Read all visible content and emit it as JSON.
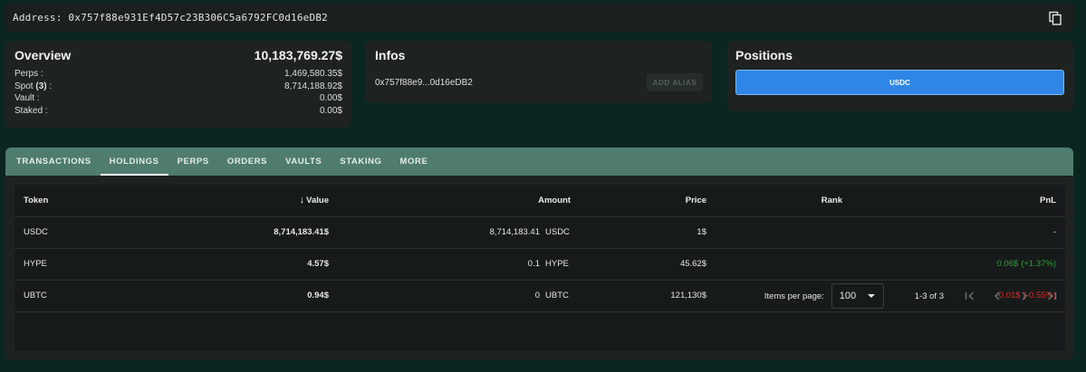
{
  "address_bar": {
    "label": "Address:",
    "address": "0x757f88e931Ef4D57c23B306C5a6792FC0d16eDB2"
  },
  "overview": {
    "title": "Overview",
    "total": "10,183,769.27$",
    "rows": [
      {
        "label": "Perps :",
        "value": "1,469,580.35$"
      },
      {
        "label": "Spot ",
        "count": "(3)",
        "suffix": " :",
        "value": "8,714,188.92$"
      },
      {
        "label": "Vault :",
        "value": "0.00$"
      },
      {
        "label": "Staked :",
        "value": "0.00$"
      }
    ]
  },
  "infos": {
    "title": "Infos",
    "short_address": "0x757f88e9...0d16eDB2",
    "alias_button": "ADD ALIAS"
  },
  "positions": {
    "title": "Positions",
    "button": "USDC"
  },
  "tabs": [
    {
      "label": "TRANSACTIONS",
      "active": false
    },
    {
      "label": "HOLDINGS",
      "active": true
    },
    {
      "label": "PERPS",
      "active": false
    },
    {
      "label": "ORDERS",
      "active": false
    },
    {
      "label": "VAULTS",
      "active": false
    },
    {
      "label": "STAKING",
      "active": false
    },
    {
      "label": "MORE",
      "active": false
    }
  ],
  "table": {
    "headers": {
      "token": "Token",
      "value": "Value",
      "amount": "Amount",
      "price": "Price",
      "rank": "Rank",
      "pnl": "PnL"
    },
    "rows": [
      {
        "token": "USDC",
        "value": "8,714,183.41$",
        "amount": "8,714,183.41",
        "unit": "USDC",
        "price": "1$",
        "rank": "",
        "pnl": "-",
        "pnl_pct": ""
      },
      {
        "token": "HYPE",
        "value": "4.57$",
        "amount": "0.1",
        "unit": "HYPE",
        "price": "45.62$",
        "rank": "",
        "pnl": "0.06$",
        "pnl_pct": "(+1.37%)"
      },
      {
        "token": "UBTC",
        "value": "0.94$",
        "amount": "0",
        "unit": "UBTC",
        "price": "121,130$",
        "rank": "",
        "pnl": "-0.01$",
        "pnl_pct": "(-0.55%)"
      }
    ]
  },
  "pagination": {
    "items_per_page_label": "Items per page:",
    "items_per_page": "100",
    "range": "1-3 of 3"
  },
  "colors": {
    "background": "#0b2620",
    "tab_bar": "#4f7c6e",
    "accent_blue": "#2f86e6",
    "pnl_positive": "#2e9e3a",
    "pnl_negative": "#e02a2a"
  },
  "icons": {
    "copy": "copy-icon",
    "sort": "arrow-down-icon",
    "dropdown": "caret-down-icon",
    "first_page": "first-page-icon",
    "prev_page": "chevron-left-icon",
    "next_page": "chevron-right-icon",
    "last_page": "last-page-icon"
  }
}
